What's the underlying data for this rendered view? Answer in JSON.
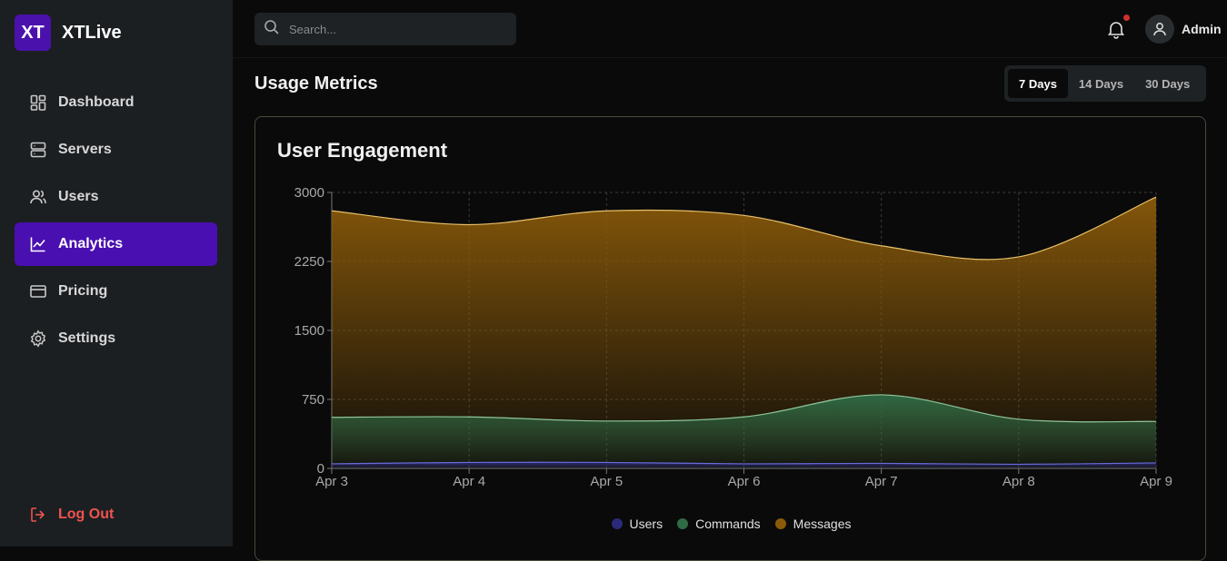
{
  "brand": {
    "logo_text": "XT",
    "name": "XTLive",
    "accent": "#4a11ad"
  },
  "search": {
    "placeholder": "Search..."
  },
  "user": {
    "name": "Admin"
  },
  "sidebar": {
    "items": [
      {
        "label": "Dashboard",
        "icon": "dashboard-icon"
      },
      {
        "label": "Servers",
        "icon": "server-icon"
      },
      {
        "label": "Users",
        "icon": "users-icon"
      },
      {
        "label": "Analytics",
        "icon": "chart-line-icon",
        "active": true
      },
      {
        "label": "Pricing",
        "icon": "credit-card-icon"
      },
      {
        "label": "Settings",
        "icon": "gear-icon"
      }
    ],
    "logout_label": "Log Out"
  },
  "main": {
    "title": "Usage Metrics",
    "ranges": [
      "7 Days",
      "14 Days",
      "30 Days"
    ],
    "active_range": "7 Days"
  },
  "card": {
    "title": "User Engagement"
  },
  "chart_data": {
    "type": "area",
    "title": "User Engagement",
    "stacked": false,
    "categories": [
      "Apr 3",
      "Apr 4",
      "Apr 5",
      "Apr 6",
      "Apr 7",
      "Apr 8",
      "Apr 9"
    ],
    "ylim": [
      0,
      3000
    ],
    "yticks": [
      0,
      750,
      1500,
      2250,
      3000
    ],
    "grid": true,
    "legend_position": "bottom",
    "series": [
      {
        "name": "Users",
        "color": "#2b2a7a",
        "values": [
          50,
          65,
          65,
          50,
          55,
          45,
          60
        ]
      },
      {
        "name": "Commands",
        "color": "#2f6b45",
        "values": [
          555,
          560,
          515,
          560,
          800,
          535,
          510
        ]
      },
      {
        "name": "Messages",
        "color": "#8a5a0a",
        "values": [
          2800,
          2650,
          2800,
          2750,
          2420,
          2300,
          2950
        ]
      }
    ]
  }
}
